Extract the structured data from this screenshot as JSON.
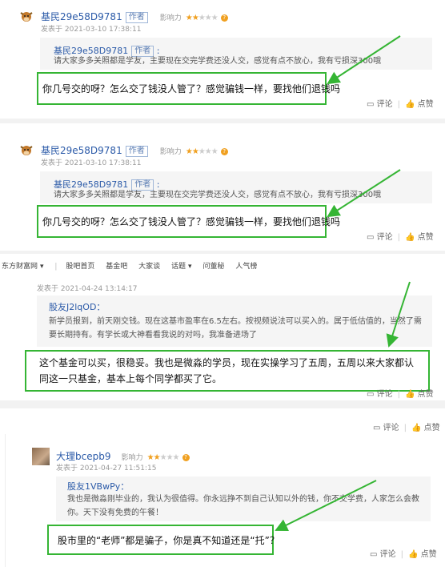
{
  "posts": [
    {
      "username": "基民29e58D9781",
      "author_badge": "作者",
      "influence_label": "影响力",
      "influence_stars": 1.5,
      "posted_at": "发表于 2021-03-10 17:38:11",
      "quote_name": "基民29e58D9781",
      "quote_badge": "作者",
      "quote_text": "请大家多多关照都是学友，主要现在交完学费还没人交，感觉有点不放心，我有亏损深300哦",
      "reply": "你几号交的呀？怎么交了钱没人管了？感觉骗钱一样，要找他们退钱吗",
      "comment_label": "评论",
      "like_label": "点赞"
    },
    {
      "username": "基民29e58D9781",
      "author_badge": "作者",
      "influence_label": "影响力",
      "influence_stars": 1.5,
      "posted_at": "发表于 2021-03-10 17:38:11",
      "quote_name": "基民29e58D9781",
      "quote_badge": "作者",
      "quote_text": "请大家多多关照都是学友，主要现在交完学费还没人交，感觉有点不放心，我有亏损深300哦",
      "reply": "你几号交的呀？怎么交了钱没人管了？感觉骗钱一样，要找他们退钱吗",
      "comment_label": "评论",
      "like_label": "点赞"
    },
    {
      "posted_at": "发表于 2021-04-24 13:14:17",
      "quote_name": "股友J2lqOD：",
      "quote_text": "新学员报到，前天刚交钱。现在这基市盈率在6.5左右。按视频说法可以买入的。属于低估值的，当然了需要长期持有。有学长或大神看看我说的对吗，我准备进场了",
      "reply": "这个基金可以买，很稳妥。我也是微淼的学员，现在实操学习了五周，五周以来大家都认同这一只基金，基本上每个同学都买了它。",
      "comment_label": "评论",
      "like_label": "点赞"
    },
    {
      "username": "大理bcepb9",
      "influence_label": "影响力",
      "influence_stars": 2,
      "posted_at": "发表于 2021-04-27 11:51:15",
      "quote_name": "股友1VBwPy：",
      "quote_text": "我也是微淼刚毕业的，我认为很值得。你永远挣不到自己认知以外的钱，你不交学费，人家怎么会教你。天下没有免费的午餐！",
      "reply": "股市里的“老师”都是骗子，你是真不知道还是“托”？",
      "comment_label": "评论",
      "like_label": "点赞"
    }
  ],
  "nav": [
    "东方财富网",
    "股吧首页",
    "基金吧",
    "大家谈",
    "话题",
    "问董秘",
    "人气榜"
  ],
  "extra_actions": {
    "comment_label": "评论",
    "like_label": "点赞"
  },
  "colors": {
    "highlight": "#35b534",
    "link": "#2b5aa8",
    "star": "#f0a020"
  }
}
